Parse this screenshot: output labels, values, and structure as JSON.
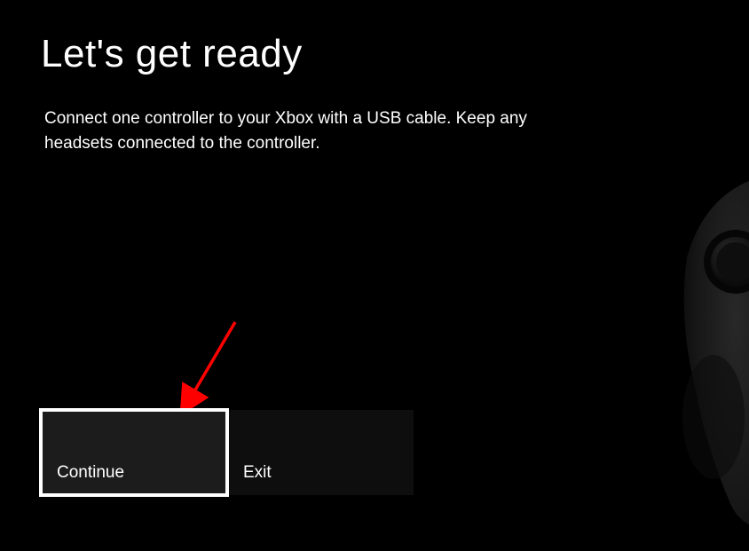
{
  "page": {
    "title": "Let's get ready",
    "subtitle": "Connect one controller to your Xbox with a USB cable. Keep any headsets connected to the controller."
  },
  "buttons": {
    "continue": "Continue",
    "exit": "Exit"
  }
}
